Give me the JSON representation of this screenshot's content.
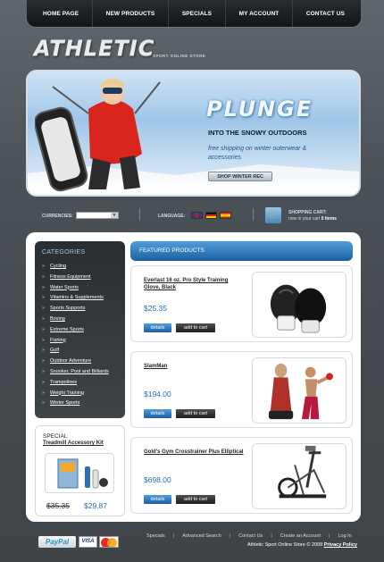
{
  "nav": {
    "items": [
      "HOME PAGE",
      "NEW PRODUCTS",
      "SPECIALS",
      "MY ACCOUNT",
      "CONTACT US"
    ]
  },
  "brand": {
    "logo": "ATHLETIC",
    "tagline": "SPORT ONLINE STORE"
  },
  "banner": {
    "headline": "PLUNGE",
    "subheadline": "INTO THE SNOWY OUTDOORS",
    "text": "free shipping on winter outerwear & accessories",
    "button": "SHOP WINTER REC"
  },
  "toolbar": {
    "currencies_label": "CURRENCIES:",
    "currency_value": "",
    "language_label": "LANGUAGE:",
    "languages": [
      "english-flag",
      "german-flag",
      "spanish-flag"
    ],
    "cart_title": "SHOPPING CART:",
    "cart_text_prefix": "now in your cart",
    "cart_count": "0 items"
  },
  "categories": {
    "title": "CATEGORIES",
    "items": [
      "Cycling",
      "Fitness Equipment",
      "Water Sports",
      "Vitamins & Supplements",
      "Sports Supports",
      "Boxing",
      "Extreme Sports",
      "Fishing",
      "Golf",
      "Outdoor Adventure",
      "Snooker, Pool and Billiards",
      "Trampolines",
      "Weight Training",
      "Winter Sports"
    ]
  },
  "special": {
    "heading": "SPECIAL",
    "product": "Treadmill Accessory Kit",
    "old_price": "$35.35",
    "new_price": "$29.87"
  },
  "featured": {
    "heading": "FEATURED PRODUCTS",
    "details_label": "details",
    "cart_label": "add to cart",
    "products": [
      {
        "name": "Everlast 16 oz. Pro Style Training Glove, Black",
        "price": "$25.35",
        "image": "boxing-gloves-image"
      },
      {
        "name": "SlamMan",
        "price": "$194.00",
        "image": "slamman-image"
      },
      {
        "name": "Gold's Gym Crosstrainer Plus Elliptical",
        "price": "$698.00",
        "image": "elliptical-image"
      }
    ]
  },
  "footer": {
    "links": [
      "Specials",
      "Advanced Search",
      "Contact Us",
      "Create an Account",
      "Log In"
    ],
    "copyright": "Athletic Sport Online Store © 2008",
    "privacy": "Privacy Policy",
    "payments": {
      "paypal_1": "Pay",
      "paypal_2": "Pal",
      "visa": "VISA"
    }
  },
  "colors": {
    "accent": "#1e6db8",
    "nav_bg": "#1a1d20",
    "page_bg": "#4c5358"
  }
}
